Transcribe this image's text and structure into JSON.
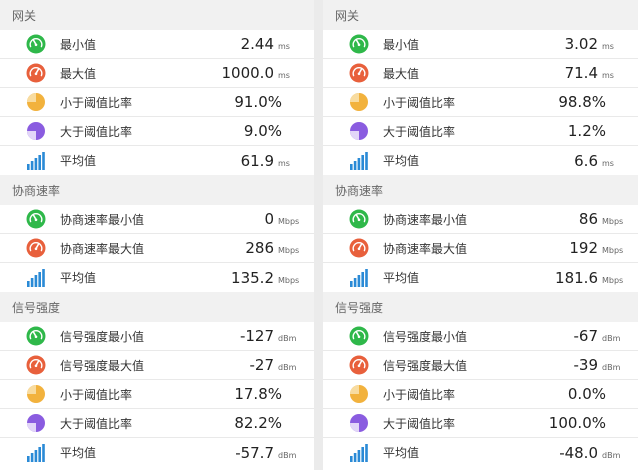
{
  "colors": {
    "min": "#2fb84a",
    "max": "#e8603c",
    "below": "#f2b23d",
    "above": "#8a5ce0",
    "avg": "#2a8ad6"
  },
  "panels": [
    {
      "sections": [
        {
          "title": "网关",
          "rows": [
            {
              "icon": "gauge-min-icon",
              "label": "最小值",
              "value": "2.44",
              "unit": "ms"
            },
            {
              "icon": "gauge-max-icon",
              "label": "最大值",
              "value": "1000.0",
              "unit": "ms"
            },
            {
              "icon": "pie-below-icon",
              "label": "小于阈值比率",
              "value": "91.0%",
              "unit": ""
            },
            {
              "icon": "pie-above-icon",
              "label": "大于阈值比率",
              "value": "9.0%",
              "unit": ""
            },
            {
              "icon": "bars-average-icon",
              "label": "平均值",
              "value": "61.9",
              "unit": "ms"
            }
          ]
        },
        {
          "title": "协商速率",
          "rows": [
            {
              "icon": "gauge-min-icon",
              "label": "协商速率最小值",
              "value": "0",
              "unit": "Mbps"
            },
            {
              "icon": "gauge-max-icon",
              "label": "协商速率最大值",
              "value": "286",
              "unit": "Mbps"
            },
            {
              "icon": "bars-average-icon",
              "label": "平均值",
              "value": "135.2",
              "unit": "Mbps"
            }
          ]
        },
        {
          "title": "信号强度",
          "rows": [
            {
              "icon": "gauge-min-icon",
              "label": "信号强度最小值",
              "value": "-127",
              "unit": "dBm"
            },
            {
              "icon": "gauge-max-icon",
              "label": "信号强度最大值",
              "value": "-27",
              "unit": "dBm"
            },
            {
              "icon": "pie-below-icon",
              "label": "小于阈值比率",
              "value": "17.8%",
              "unit": ""
            },
            {
              "icon": "pie-above-icon",
              "label": "大于阈值比率",
              "value": "82.2%",
              "unit": ""
            },
            {
              "icon": "bars-average-icon",
              "label": "平均值",
              "value": "-57.7",
              "unit": "dBm"
            }
          ]
        }
      ]
    },
    {
      "sections": [
        {
          "title": "网关",
          "rows": [
            {
              "icon": "gauge-min-icon",
              "label": "最小值",
              "value": "3.02",
              "unit": "ms"
            },
            {
              "icon": "gauge-max-icon",
              "label": "最大值",
              "value": "71.4",
              "unit": "ms"
            },
            {
              "icon": "pie-below-icon",
              "label": "小于阈值比率",
              "value": "98.8%",
              "unit": ""
            },
            {
              "icon": "pie-above-icon",
              "label": "大于阈值比率",
              "value": "1.2%",
              "unit": ""
            },
            {
              "icon": "bars-average-icon",
              "label": "平均值",
              "value": "6.6",
              "unit": "ms"
            }
          ]
        },
        {
          "title": "协商速率",
          "rows": [
            {
              "icon": "gauge-min-icon",
              "label": "协商速率最小值",
              "value": "86",
              "unit": "Mbps"
            },
            {
              "icon": "gauge-max-icon",
              "label": "协商速率最大值",
              "value": "192",
              "unit": "Mbps"
            },
            {
              "icon": "bars-average-icon",
              "label": "平均值",
              "value": "181.6",
              "unit": "Mbps"
            }
          ]
        },
        {
          "title": "信号强度",
          "rows": [
            {
              "icon": "gauge-min-icon",
              "label": "信号强度最小值",
              "value": "-67",
              "unit": "dBm"
            },
            {
              "icon": "gauge-max-icon",
              "label": "信号强度最大值",
              "value": "-39",
              "unit": "dBm"
            },
            {
              "icon": "pie-below-icon",
              "label": "小于阈值比率",
              "value": "0.0%",
              "unit": ""
            },
            {
              "icon": "pie-above-icon",
              "label": "大于阈值比率",
              "value": "100.0%",
              "unit": ""
            },
            {
              "icon": "bars-average-icon",
              "label": "平均值",
              "value": "-48.0",
              "unit": "dBm"
            }
          ]
        }
      ]
    }
  ]
}
